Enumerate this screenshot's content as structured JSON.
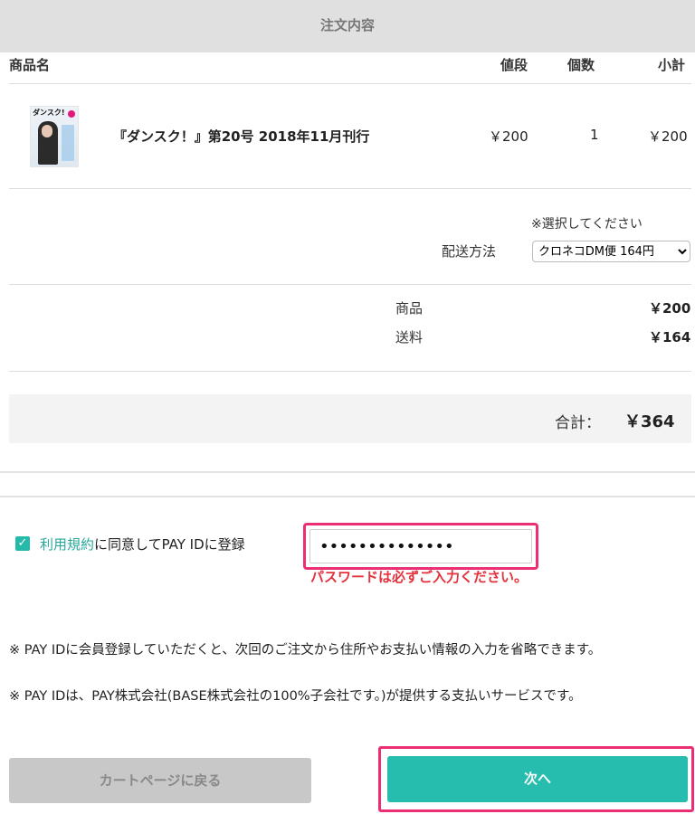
{
  "header": {
    "title": "注文内容"
  },
  "table": {
    "columns": {
      "product": "商品名",
      "price": "値段",
      "qty": "個数",
      "subtotal": "小計"
    },
    "items": [
      {
        "thumb_title": "ダンスク!",
        "name": "『ダンスク！』第20号 2018年11月刊行",
        "price": "￥200",
        "qty": "1",
        "subtotal": "￥200"
      }
    ]
  },
  "shipping": {
    "hint": "※選択してください",
    "label": "配送方法",
    "selected": "クロネコDM便 164円"
  },
  "summary": {
    "product_label": "商品",
    "product_value": "￥200",
    "shipping_label": "送料",
    "shipping_value": "￥164",
    "total_label": "合計：",
    "total_value": "￥364"
  },
  "payid": {
    "checked": true,
    "terms_link": "利用規約",
    "agree_text": "に同意してPAY IDに登録",
    "password_value": "••••••••••••••",
    "password_error": "パスワードは必ずご入力ください。",
    "notes": [
      "※ PAY IDに会員登録していただくと、次回のご注文から住所やお支払い情報の入力を省略できます。",
      "※ PAY IDは、PAY株式会社(BASE株式会社の100%子会社です。)が提供する支払いサービスです。"
    ]
  },
  "buttons": {
    "back": "カートページに戻る",
    "next": "次へ"
  },
  "colors": {
    "accent": "#26bdae",
    "highlight": "#ec2f74",
    "error": "#e3323c"
  }
}
